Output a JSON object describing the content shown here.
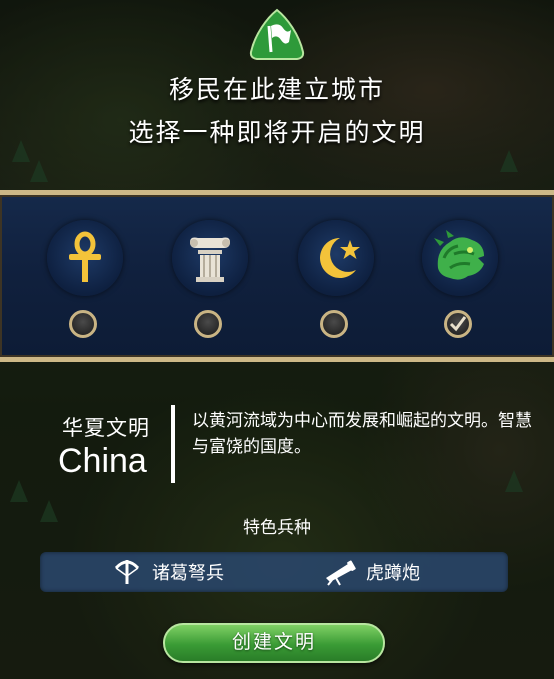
{
  "header": {
    "icon": "settler-flag-icon",
    "line1": "移民在此建立城市",
    "line2": "选择一种即将开启的文明"
  },
  "civilizations": [
    {
      "icon": "ankh-icon",
      "selected": false
    },
    {
      "icon": "column-capital-icon",
      "selected": false
    },
    {
      "icon": "crescent-star-icon",
      "selected": false
    },
    {
      "icon": "dragon-head-icon",
      "selected": true
    }
  ],
  "selected_civ": {
    "name_cn": "华夏文明",
    "name_en": "China",
    "description": "以黄河流域为中心而发展和崛起的文明。智慧与富饶的国度。"
  },
  "special_units": {
    "label": "特色兵种",
    "units": [
      {
        "icon": "crossbow-icon",
        "name": "诸葛弩兵"
      },
      {
        "icon": "cannon-icon",
        "name": "虎蹲炮"
      }
    ]
  },
  "create_button": "创建文明",
  "colors": {
    "accent_gold": "#cdb887",
    "strip_blue": "#10203d",
    "button_green": "#3a9b35"
  }
}
